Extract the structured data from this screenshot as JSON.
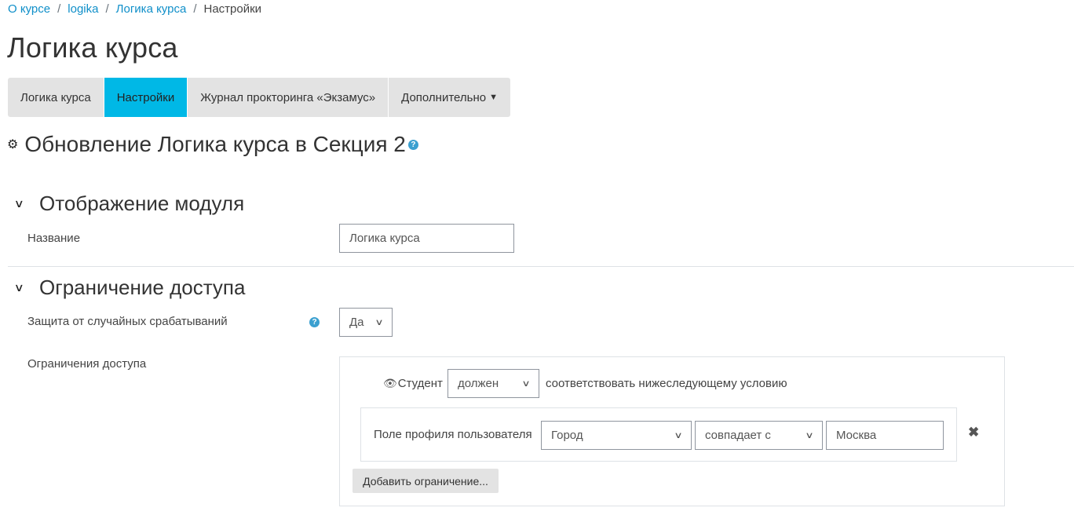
{
  "breadcrumb": {
    "items": [
      "О курсе",
      "logika",
      "Логика курса"
    ],
    "current": "Настройки",
    "separator": "/"
  },
  "page_title": "Логика курса",
  "tabs": [
    {
      "label": "Логика курса",
      "active": false
    },
    {
      "label": "Настройки",
      "active": true
    },
    {
      "label": "Журнал прокторинга «Экзамус»",
      "active": false
    },
    {
      "label": "Дополнительно",
      "active": false
    }
  ],
  "heading": {
    "text": "Обновление Логика курса в Секция 2",
    "help": "?"
  },
  "module_display": {
    "legend": "Отображение модуля",
    "name_label": "Название",
    "name_value": "Логика курса"
  },
  "restrict_access": {
    "legend": "Ограничение доступа",
    "protection_label": "Защита от случайных срабатываний",
    "protection_value": "Да",
    "restrictions_label": "Ограничения доступа",
    "student_label": "Студент",
    "must_value": "должен",
    "condition_text": "соответствовать нижеследующему условию",
    "profile_label": "Поле профиля пользователя",
    "field_value": "Город",
    "operator_value": "совпадает с",
    "match_value": "Москва",
    "add_button": "Добавить ограничение..."
  },
  "colors": {
    "accent": "#00b8e6",
    "link": "#0f8fc9",
    "help_icon": "#3ba0d0",
    "tab_bg": "#e3e3e3"
  }
}
